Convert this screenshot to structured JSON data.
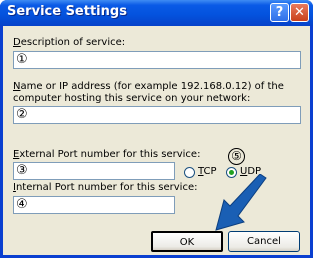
{
  "dialog": {
    "title": "Service Settings",
    "help_glyph": "?",
    "close_glyph": "✕"
  },
  "fields": {
    "description": {
      "label_accesskey": "D",
      "label_rest": "escription of service:",
      "value": "①"
    },
    "host": {
      "label_accesskey": "N",
      "label_rest": "ame or IP address (for example 192.168.0.12) of the computer hosting this service on your network:",
      "value": "②"
    },
    "external_port": {
      "label_accesskey": "E",
      "label_rest": "xternal Port number for this service:",
      "value": "③"
    },
    "internal_port": {
      "label_accesskey": "I",
      "label_rest": "nternal Port number for this service:",
      "value": "④"
    }
  },
  "protocol": {
    "callout": "⑤",
    "options": [
      {
        "accesskey": "T",
        "rest": "CP",
        "selected": false
      },
      {
        "accesskey": "U",
        "rest": "DP",
        "selected": true
      }
    ]
  },
  "buttons": {
    "ok": "OK",
    "cancel": "Cancel"
  },
  "colors": {
    "titlebar": "#0453de",
    "dialog_bg": "#ece9d8",
    "field_border": "#7f9db9",
    "arrow": "#1a5fb4"
  },
  "icons": {
    "pointer": "arrow-pointer-icon"
  }
}
